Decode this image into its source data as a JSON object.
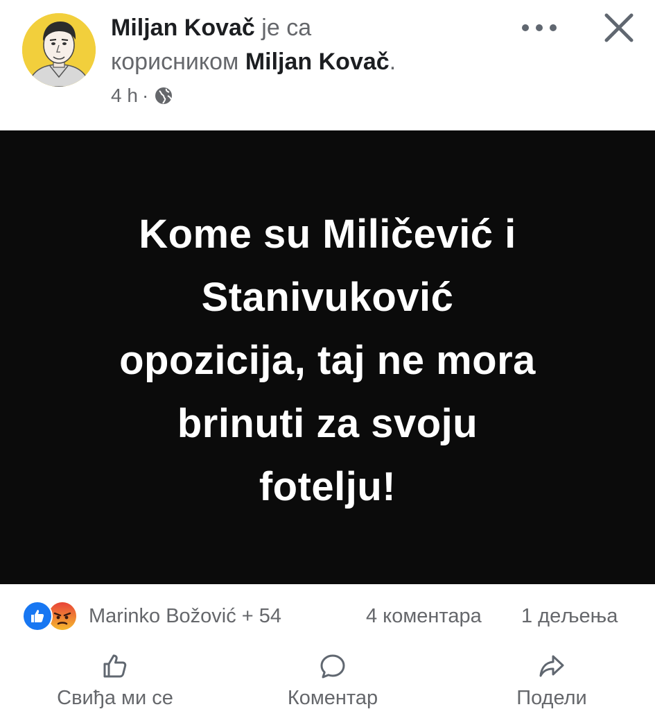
{
  "post": {
    "author": "Miljan Kovač",
    "with_text": "је са",
    "with_prefix": "корисником",
    "tagged_user": "Miljan Kovač",
    "tagged_suffix": ".",
    "time": "4 h",
    "time_separator": "·",
    "audience_icon": "globe-icon",
    "image_text": "Kome su Miličević i\nStanivuković\nopozicija, taj ne mora\nbrinuti za svoju\nfotelju!"
  },
  "header": {
    "more_icon": "more-horizontal-icon",
    "close_icon": "close-icon"
  },
  "reactions": {
    "icons": [
      "like-reaction-icon",
      "angry-reaction-icon"
    ],
    "summary": "Marinko Božović + 54",
    "comments": "4 коментара",
    "shares": "1 дељења"
  },
  "actions": {
    "like_label": "Свиђа ми се",
    "comment_label": "Коментар",
    "share_label": "Подели",
    "like_icon": "thumbs-up-icon",
    "comment_icon": "comment-bubble-icon",
    "share_icon": "share-arrow-icon"
  },
  "colors": {
    "like_blue": "#1877f2",
    "angry_orange": "#f0a11f",
    "secondary_text": "#65676b",
    "image_background": "#0b0b0b"
  }
}
